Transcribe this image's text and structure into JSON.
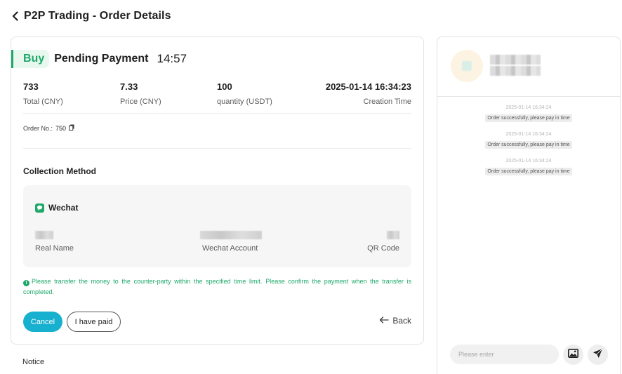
{
  "header": {
    "title": "P2P Trading - Order Details"
  },
  "order": {
    "side": "Buy",
    "status": "Pending Payment",
    "countdown": "14:57",
    "summary": [
      {
        "value": "733",
        "label": "Total (CNY)"
      },
      {
        "value": "7.33",
        "label": "Price (CNY)"
      },
      {
        "value": "100",
        "label": "quantity (USDT)"
      },
      {
        "value": "2025-01-14 16:34:23",
        "label": "Creation Time"
      }
    ],
    "order_no_label": "Order No.:",
    "order_no": "750"
  },
  "collection": {
    "title": "Collection Method",
    "method_name": "Wechat",
    "real_name_label": "Real Name",
    "account_label": "Wechat Account",
    "qr_label": "QR Code"
  },
  "notice_message": "Please transfer the money to the counter-party within the specified time limit. Please confirm the payment when the transfer is completed.",
  "actions": {
    "cancel": "Cancel",
    "paid": "I have paid",
    "back": "Back"
  },
  "notice_label": "Notice",
  "chat": {
    "messages": [
      {
        "time": "2025-01-14 16:34:24",
        "text": "Order successfully, please pay in time"
      },
      {
        "time": "2025-01-14 16:34:24",
        "text": "Order successfully, please pay in time"
      },
      {
        "time": "2025-01-14 16:34:24",
        "text": "Order successfully, please pay in time"
      }
    ],
    "input_placeholder": "Please enter"
  },
  "colors": {
    "accent_green": "#1ea86a",
    "cancel_blue": "#17b0cf"
  },
  "icons": [
    "chevron-left-icon",
    "copy-icon",
    "wechat-icon",
    "info-icon",
    "arrow-left-icon",
    "image-icon",
    "send-icon"
  ]
}
